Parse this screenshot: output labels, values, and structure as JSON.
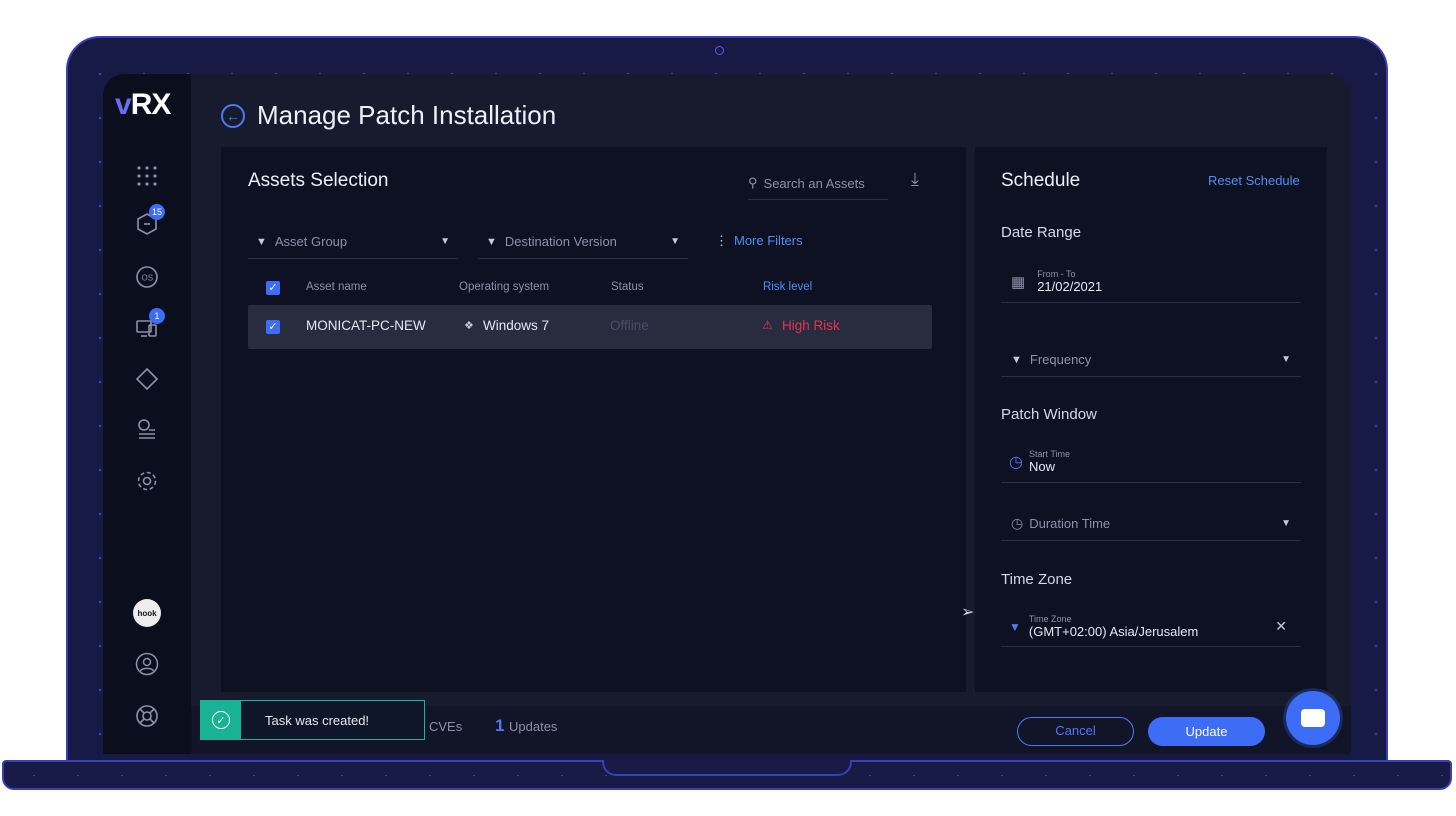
{
  "app": {
    "logo_prefix": "v",
    "logo_rest": "RX"
  },
  "header": {
    "title": "Manage Patch Installation"
  },
  "sidebar": {
    "badges": {
      "patches": "15",
      "devices": "1"
    },
    "avatar_text": "hook"
  },
  "assets": {
    "title": "Assets Selection",
    "search_placeholder": "Search an Assets",
    "filters": {
      "asset_group": "Asset Group",
      "destination_version": "Destination Version",
      "more": "More Filters"
    },
    "columns": [
      "Asset name",
      "Operating system",
      "Status",
      "Risk level"
    ],
    "rows": [
      {
        "name": "MONICAT-PC-NEW",
        "os": "Windows 7",
        "status": "Offline",
        "risk": "High Risk"
      }
    ]
  },
  "schedule": {
    "title": "Schedule",
    "reset": "Reset Schedule",
    "date_range_label": "Date Range",
    "from_to_label": "From - To",
    "from_to_value": "21/02/2021",
    "frequency": "Frequency",
    "patch_window_label": "Patch Window",
    "start_time_label": "Start Time",
    "start_time_value": "Now",
    "duration_time": "Duration Time",
    "time_zone_label": "Time Zone",
    "time_zone_small": "Time Zone",
    "time_zone_value": "(GMT+02:00) Asia/Jerusalem"
  },
  "bottom": {
    "toast": "Task was created!",
    "cves_label": "CVEs",
    "updates_count": "1",
    "updates_label": "Updates",
    "cancel": "Cancel",
    "update": "Update"
  },
  "colors": {
    "accent": "#3d6cf6",
    "link": "#4f8ef7",
    "risk_high": "#e2344f",
    "success": "#18b394"
  }
}
